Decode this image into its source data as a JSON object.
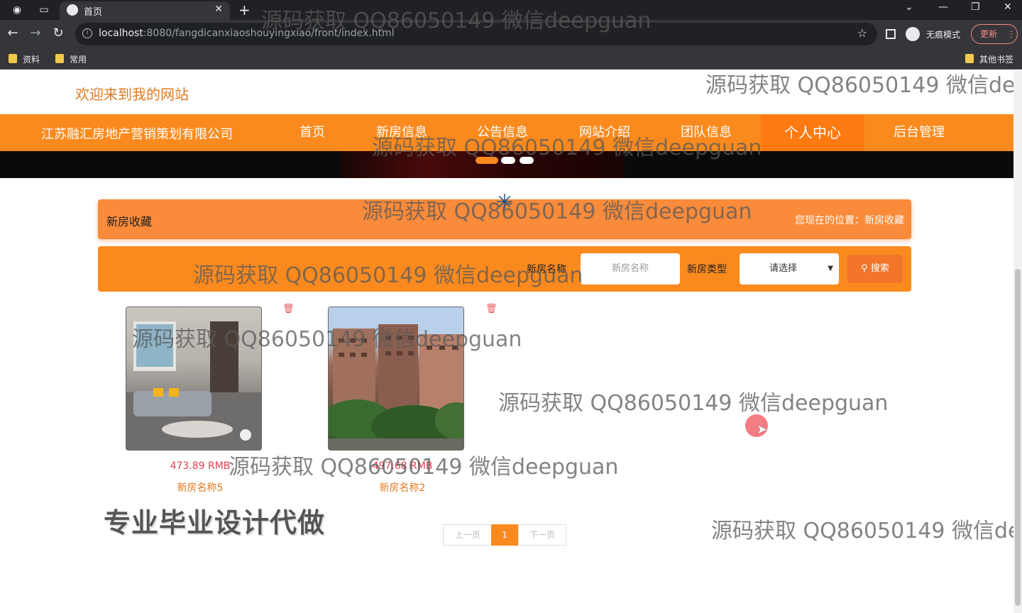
{
  "browser": {
    "tab_title": "首页",
    "url_host": "localhost",
    "url_path": ":8080/fangdicanxiaoshouyingxiao/front/index.html",
    "incognito_label": "无痕模式",
    "update_label": "更新",
    "bookmarks": [
      "资料",
      "常用"
    ],
    "other_bookmarks": "其他书签"
  },
  "header": {
    "welcome": "欢迎来到我的网站"
  },
  "nav": {
    "company": "江苏融汇房地产营销策划有限公司",
    "items": [
      "首页",
      "新房信息",
      "公告信息",
      "网站介绍",
      "团队信息",
      "个人中心",
      "后台管理"
    ],
    "active": "个人中心"
  },
  "breadcrumb": {
    "title": "新房收藏",
    "location": "您现在的位置：新房收藏"
  },
  "search": {
    "name_label": "新房名称",
    "name_placeholder": "新房名称",
    "type_label": "新房类型",
    "type_selected": "请选择",
    "button_label": "搜索"
  },
  "favorites": [
    {
      "price": "473.89 RMB",
      "name": "新房名称5",
      "image": "living-room-photo"
    },
    {
      "price": "497.68 RMB",
      "name": "新房名称2",
      "image": "apartment-building-photo"
    }
  ],
  "pagination": {
    "prev": "上一页",
    "current": "1",
    "next": "下一页"
  },
  "overlay_text": "专业毕业设计代做",
  "watermark": "源码获取 QQ86050149 微信deepguan"
}
